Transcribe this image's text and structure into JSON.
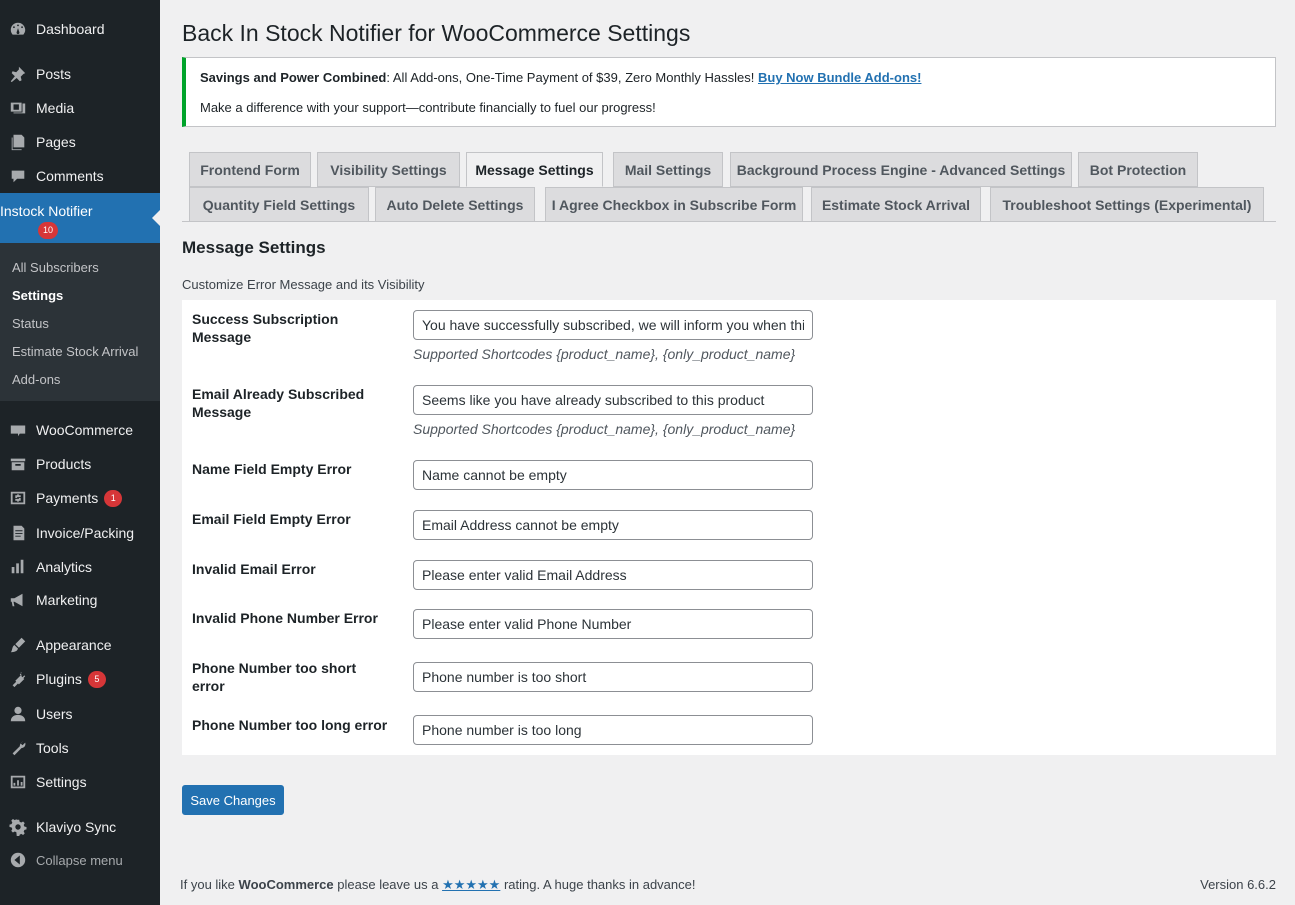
{
  "sidebar": {
    "items": [
      {
        "label": "Dashboard",
        "icon": "dashboard-icon"
      },
      {
        "label": "Posts",
        "icon": "pin-icon"
      },
      {
        "label": "Media",
        "icon": "media-icon"
      },
      {
        "label": "Pages",
        "icon": "pages-icon"
      },
      {
        "label": "Comments",
        "icon": "comments-icon"
      },
      {
        "label": "Instock Notifier",
        "icon": "notifier-icon",
        "badge": "10"
      },
      {
        "label": "WooCommerce",
        "icon": "woo-icon"
      },
      {
        "label": "Products",
        "icon": "products-icon"
      },
      {
        "label": "Payments",
        "icon": "payments-icon",
        "badge": "1"
      },
      {
        "label": "Invoice/Packing",
        "icon": "invoice-icon"
      },
      {
        "label": "Analytics",
        "icon": "analytics-icon"
      },
      {
        "label": "Marketing",
        "icon": "megaphone-icon"
      },
      {
        "label": "Appearance",
        "icon": "brush-icon"
      },
      {
        "label": "Plugins",
        "icon": "plug-icon",
        "badge": "5"
      },
      {
        "label": "Users",
        "icon": "user-icon"
      },
      {
        "label": "Tools",
        "icon": "wrench-icon"
      },
      {
        "label": "Settings",
        "icon": "settings-icon"
      },
      {
        "label": "Klaviyo Sync",
        "icon": "gear-icon"
      },
      {
        "label": "Collapse menu",
        "icon": "collapse-icon"
      }
    ],
    "submenu": [
      "All Subscribers",
      "Settings",
      "Status",
      "Estimate Stock Arrival",
      "Add-ons"
    ]
  },
  "page": {
    "title": "Back In Stock Notifier for WooCommerce Settings"
  },
  "notice": {
    "bold": "Savings and Power Combined",
    "text": ": All Add-ons, One-Time Payment of $39, Zero Monthly Hassles! ",
    "link": "Buy Now Bundle Add-ons!",
    "line2": "Make a difference with your support—contribute financially to fuel our progress!"
  },
  "tabs": [
    "Frontend Form",
    "Visibility Settings",
    "Message Settings",
    "Mail Settings",
    "Background Process Engine - Advanced Settings",
    "Bot Protection",
    "Quantity Field Settings",
    "Auto Delete Settings",
    "I Agree Checkbox in Subscribe Form",
    "Estimate Stock Arrival",
    "Troubleshoot Settings (Experimental)"
  ],
  "section": {
    "title": "Message Settings",
    "description": "Customize Error Message and its Visibility"
  },
  "fields": [
    {
      "label": "Success Subscription Message",
      "value": "You have successfully subscribed, we will inform you when this product is back in stock",
      "hint": "Supported Shortcodes {product_name}, {only_product_name}"
    },
    {
      "label": "Email Already Subscribed Message",
      "value": "Seems like you have already subscribed to this product",
      "hint": "Supported Shortcodes {product_name}, {only_product_name}"
    },
    {
      "label": "Name Field Empty Error",
      "value": "Name cannot be empty"
    },
    {
      "label": "Email Field Empty Error",
      "value": "Email Address cannot be empty"
    },
    {
      "label": "Invalid Email Error",
      "value": "Please enter valid Email Address"
    },
    {
      "label": "Invalid Phone Number Error",
      "value": "Please enter valid Phone Number"
    },
    {
      "label": "Phone Number too short error",
      "value": "Phone number is too short"
    },
    {
      "label": "Phone Number too long error",
      "value": "Phone number is too long"
    }
  ],
  "save_label": "Save Changes",
  "footer": {
    "prefix": "If you like ",
    "brand": "WooCommerce",
    "middle": " please leave us a ",
    "stars": "★★★★★",
    "suffix": " rating. A huge thanks in advance!",
    "version": "Version 6.6.2"
  },
  "colors": {
    "accent": "#2271b1",
    "sidebar": "#1d2327",
    "notice_border": "#00a32a",
    "badge": "#d63638"
  }
}
